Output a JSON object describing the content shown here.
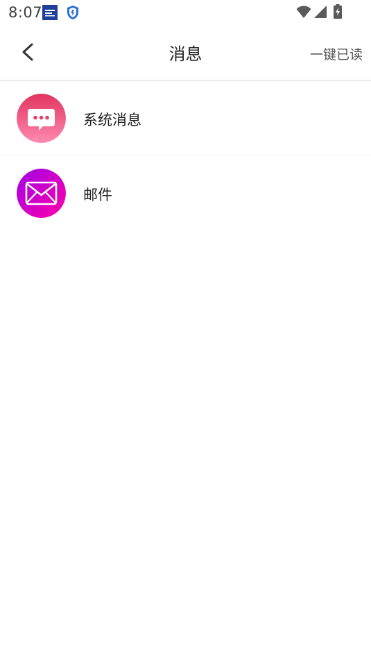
{
  "status_bar": {
    "time": "8:07",
    "icons": [
      "app-notification-icon",
      "shield-app-icon",
      "wifi-icon",
      "cell-signal-icon",
      "battery-charging-icon"
    ]
  },
  "header": {
    "title": "消息",
    "back_icon": "chevron-left-icon",
    "mark_all_read": "一键已读"
  },
  "messages": [
    {
      "label": "系统消息",
      "icon": "chat-bubble-icon",
      "icon_color_top": "#e0345f",
      "icon_color_bottom": "#ff8ab0"
    },
    {
      "label": "邮件",
      "icon": "mail-envelope-icon",
      "icon_color_top": "#a000e8",
      "icon_color_bottom": "#ff00a8"
    }
  ],
  "colors": {
    "background": "#ffffff",
    "text_primary": "#222222",
    "text_secondary": "#555555",
    "divider": "#efefef"
  }
}
